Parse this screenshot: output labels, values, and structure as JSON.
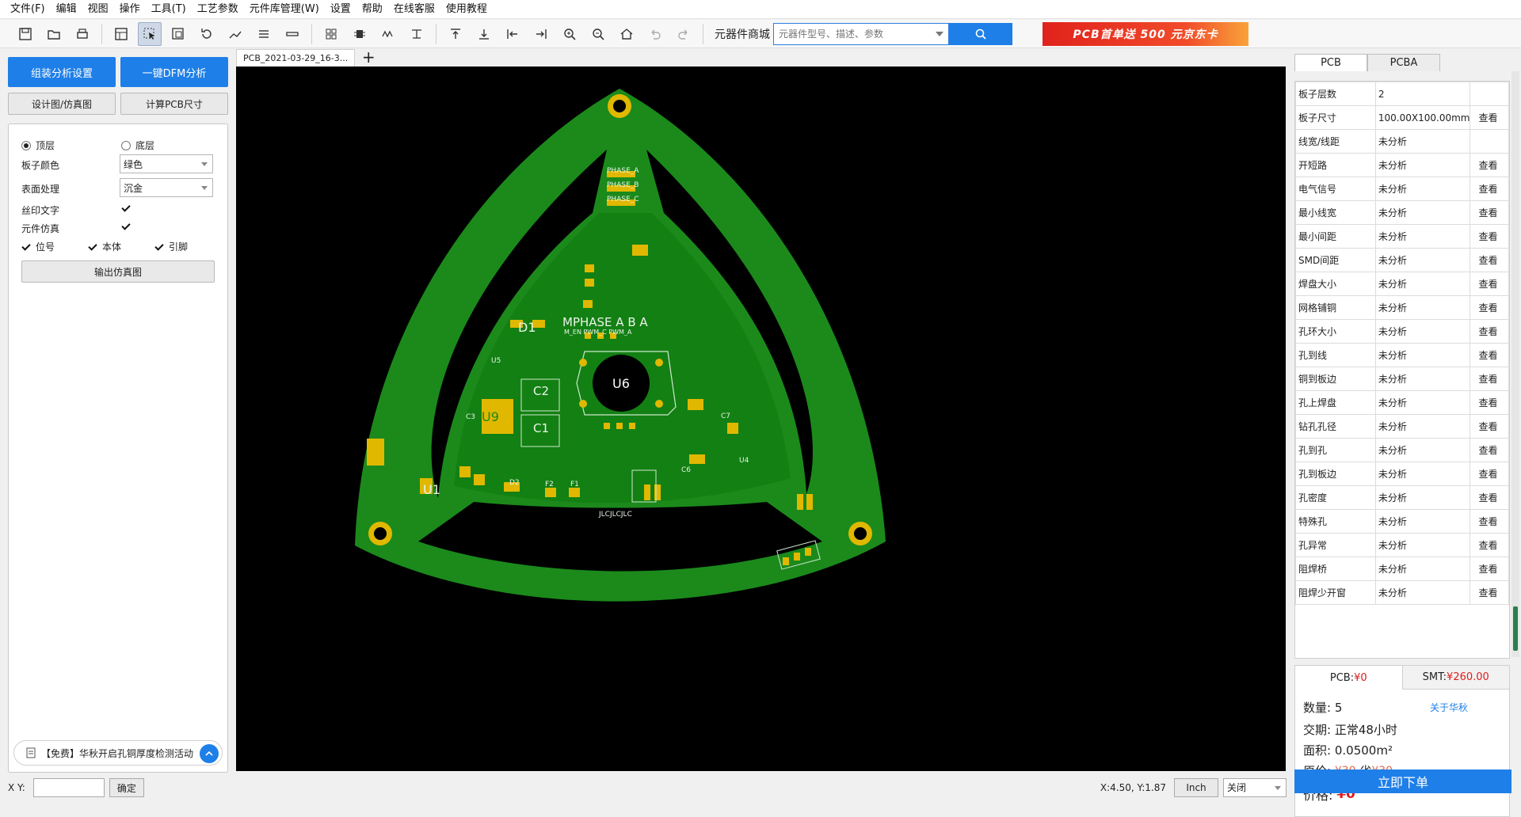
{
  "menu": [
    "文件(F)",
    "编辑",
    "视图",
    "操作",
    "工具(T)",
    "工艺参数",
    "元件库管理(W)",
    "设置",
    "帮助",
    "在线客服",
    "使用教程"
  ],
  "toolbar": {
    "store_label": "元器件商城",
    "search_placeholder": "元器件型号、描述、参数",
    "promo_text": "PCB首单送 500 元京东卡"
  },
  "left": {
    "btn_analysis_settings": "组装分析设置",
    "btn_dfm": "一键DFM分析",
    "btn_design_sim": "设计图/仿真图",
    "btn_calc_size": "计算PCB尺寸",
    "radio_top": "顶层",
    "radio_bottom": "底层",
    "board_color_label": "板子颜色",
    "board_color_value": "绿色",
    "surface_label": "表面处理",
    "surface_value": "沉金",
    "silk_label": "丝印文字",
    "component_sim_label": "元件仿真",
    "chk_ref": "位号",
    "chk_body": "本体",
    "chk_pin": "引脚",
    "btn_export_sim": "输出仿真图",
    "notice": "【免费】华秋开启孔铜厚度检测活动"
  },
  "doc_tab": "PCB_2021-03-29_16-3...",
  "canvas": {
    "board_color": "#1b8a1b",
    "pad_color": "#e0b800",
    "labels": [
      "PHASE_A",
      "PHASE_B",
      "PHASE_C",
      "U6",
      "U9",
      "U1",
      "D1",
      "D2",
      "F1",
      "F2",
      "C1",
      "C2",
      "C3",
      "C6",
      "C7",
      "U4",
      "U5",
      "MPHASE A B A",
      "M_EN PWM_C PWM_A",
      "JLCJLCJLC"
    ]
  },
  "right": {
    "tabs": [
      "PCB",
      "PCBA"
    ],
    "rows": [
      [
        "板子层数",
        "2",
        ""
      ],
      [
        "板子尺寸",
        "100.00X100.00mm",
        "查看"
      ],
      [
        "线宽/线距",
        "未分析",
        ""
      ],
      [
        "开短路",
        "未分析",
        "查看"
      ],
      [
        "电气信号",
        "未分析",
        "查看"
      ],
      [
        "最小线宽",
        "未分析",
        "查看"
      ],
      [
        "最小间距",
        "未分析",
        "查看"
      ],
      [
        "SMD间距",
        "未分析",
        "查看"
      ],
      [
        "焊盘大小",
        "未分析",
        "查看"
      ],
      [
        "网格铺铜",
        "未分析",
        "查看"
      ],
      [
        "孔环大小",
        "未分析",
        "查看"
      ],
      [
        "孔到线",
        "未分析",
        "查看"
      ],
      [
        "铜到板边",
        "未分析",
        "查看"
      ],
      [
        "孔上焊盘",
        "未分析",
        "查看"
      ],
      [
        "钻孔孔径",
        "未分析",
        "查看"
      ],
      [
        "孔到孔",
        "未分析",
        "查看"
      ],
      [
        "孔到板边",
        "未分析",
        "查看"
      ],
      [
        "孔密度",
        "未分析",
        "查看"
      ],
      [
        "特殊孔",
        "未分析",
        "查看"
      ],
      [
        "孔异常",
        "未分析",
        "查看"
      ],
      [
        "阻焊桥",
        "未分析",
        "查看"
      ],
      [
        "阻焊少开窗",
        "未分析",
        "查看"
      ]
    ],
    "price_tab_pcb_label": "PCB:",
    "price_tab_pcb_value": "¥0",
    "price_tab_smt_label": "SMT:",
    "price_tab_smt_value": "¥260.00",
    "qty_label": "数量:",
    "qty_value": "5",
    "about_link": "关于华秋",
    "delivery_label": "交期:",
    "delivery_value": "正常48小时",
    "area_label": "面积:",
    "area_value": "0.0500m²",
    "orig_label": "原价:",
    "orig_value": "¥30",
    "save_label": ",省",
    "save_value": "¥30",
    "price_label": "价格:",
    "price_value": "¥0",
    "order_btn": "立即下单"
  },
  "status": {
    "xy_label": "X Y:",
    "xy_value": "",
    "confirm_btn": "确定",
    "coords": "X:4.50, Y:1.87",
    "unit_btn": "Inch",
    "grid_select": "关闭"
  },
  "colors": {
    "accent": "#1e7fe8",
    "price_red": "#e01c1c"
  }
}
